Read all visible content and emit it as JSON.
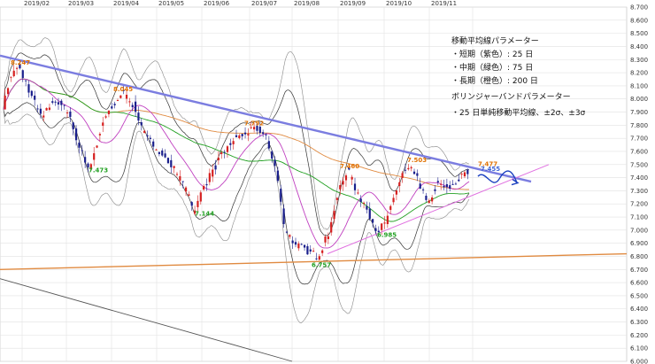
{
  "chart_data": {
    "type": "candlestick",
    "ylim": [
      6.0,
      8.7
    ],
    "y_ticks": [
      "8.700",
      "8.600",
      "8.500",
      "8.400",
      "8.300",
      "8.200",
      "8.100",
      "8.000",
      "7.900",
      "7.800",
      "7.700",
      "7.600",
      "7.500",
      "7.400",
      "7.300",
      "7.200",
      "7.100",
      "7.000",
      "6.900",
      "6.800",
      "6.700",
      "6.600",
      "6.500",
      "6.400",
      "6.300",
      "6.200",
      "6.100",
      "6.000"
    ],
    "x_labels": [
      "2019/02",
      "2019/03",
      "2019/04",
      "2019/05",
      "2019/06",
      "2019/07",
      "2019/08",
      "2019/09",
      "2019/10",
      "2019/11"
    ],
    "grid": true,
    "legend": {
      "title1": "移動平均線パラメーター",
      "item1": "・短期（紫色）: 25 日",
      "item2": "・中期（緑色）: 75 日",
      "item3": "・長期（橙色）: 200 日",
      "title2": "ボリンジャーバンドパラメーター",
      "item4": "・25 日単純移動平均線、±2σ、±3σ"
    },
    "annotations": [
      {
        "label": "8.247",
        "kind": "high"
      },
      {
        "label": "8.045",
        "kind": "high"
      },
      {
        "label": "7.473",
        "kind": "low"
      },
      {
        "label": "7.144",
        "kind": "low"
      },
      {
        "label": "7.792",
        "kind": "high"
      },
      {
        "label": "7.460",
        "kind": "high"
      },
      {
        "label": "6.757",
        "kind": "low"
      },
      {
        "label": "6.985",
        "kind": "low"
      },
      {
        "label": "7.503",
        "kind": "high"
      },
      {
        "label": "7.477",
        "kind": "high"
      },
      {
        "label": "7.455",
        "kind": "current"
      }
    ],
    "colors": {
      "up": "#d62020",
      "down": "#1a1f8c",
      "sma25": "#c040c0",
      "sma75": "#22a022",
      "sma200": "#e08a40",
      "bands": "#333333",
      "trend_down": "#7b7de0",
      "trend_up": "#e070e0",
      "support": "#e08a40",
      "forecast": "#1a3fbf",
      "high_label": "#e07000",
      "low_label": "#22a022"
    }
  }
}
